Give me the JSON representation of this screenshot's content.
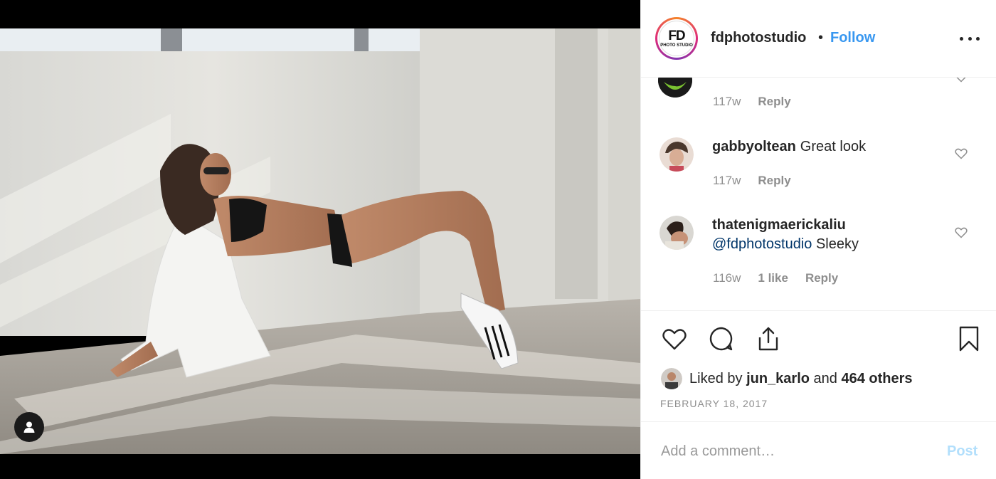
{
  "post": {
    "username": "fdphotostudio",
    "separator": "•",
    "follow_label": "Follow",
    "logo_text": "FD",
    "logo_sub": "PHOTO STUDIO",
    "more_icon": "more-horizontal-icon"
  },
  "comments": [
    {
      "username": "",
      "text": "",
      "time": "117w",
      "reply_label": "Reply"
    },
    {
      "username": "gabbyoltean",
      "text": "Great look",
      "time": "117w",
      "reply_label": "Reply"
    },
    {
      "username": "thatenigmaerickaliu",
      "mention": "@fdphotostudio",
      "text": "Sleeky",
      "time": "116w",
      "likes": "1 like",
      "reply_label": "Reply"
    }
  ],
  "likes": {
    "prefix": "Liked by",
    "user": "jun_karlo",
    "and": "and",
    "others": "464 others"
  },
  "date": "FEBRUARY 18, 2017",
  "add_comment": {
    "placeholder": "Add a comment…",
    "post_label": "Post"
  },
  "colors": {
    "accent": "#3897f0",
    "post_disabled": "#b2dffc",
    "meta": "#8e8e8e",
    "mention": "#003569"
  }
}
